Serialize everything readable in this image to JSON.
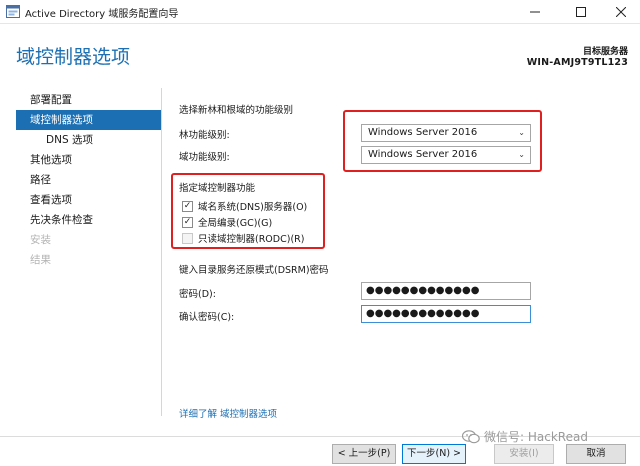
{
  "window": {
    "title": "Active Directory 域服务配置向导",
    "app_icon": "server-manager-icon",
    "controls": [
      "minimize-icon",
      "maximize-icon",
      "close-icon"
    ]
  },
  "header": {
    "page_title": "域控制器选项",
    "target_server_label": "目标服务器",
    "target_server_value": "WIN-AMJ9T9TL123"
  },
  "nav": {
    "items": [
      {
        "label": "部署配置",
        "state": "normal"
      },
      {
        "label": "域控制器选项",
        "state": "active"
      },
      {
        "label": "DNS 选项",
        "state": "sub"
      },
      {
        "label": "其他选项",
        "state": "normal"
      },
      {
        "label": "路径",
        "state": "normal"
      },
      {
        "label": "查看选项",
        "state": "normal"
      },
      {
        "label": "先决条件检查",
        "state": "normal"
      },
      {
        "label": "安装",
        "state": "disabled"
      },
      {
        "label": "结果",
        "state": "disabled"
      }
    ]
  },
  "functional_level": {
    "section_label": "选择新林和根域的功能级别",
    "forest_label": "林功能级别:",
    "forest_value": "Windows Server 2016",
    "domain_label": "域功能级别:",
    "domain_value": "Windows Server 2016"
  },
  "dc_capabilities": {
    "section_label": "指定域控制器功能",
    "options": [
      {
        "label": "域名系统(DNS)服务器(O)",
        "checked": true,
        "enabled": true
      },
      {
        "label": "全局编录(GC)(G)",
        "checked": true,
        "enabled": true
      },
      {
        "label": "只读域控制器(RODC)(R)",
        "checked": false,
        "enabled": false
      }
    ]
  },
  "dsrm": {
    "section_label": "键入目录服务还原模式(DSRM)密码",
    "password_label": "密码(D):",
    "password_value": "●●●●●●●●●●●●●",
    "confirm_label": "确认密码(C):",
    "confirm_value": "●●●●●●●●●●●●●"
  },
  "learn_more": "详细了解 域控制器选项",
  "buttons": {
    "back": "< 上一步(P)",
    "next": "下一步(N) >",
    "install": "安装(I)",
    "cancel": "取消"
  },
  "watermark": "微信号: HackRead",
  "colors": {
    "accent": "#1c6fb3",
    "highlight_box": "#e02020"
  }
}
